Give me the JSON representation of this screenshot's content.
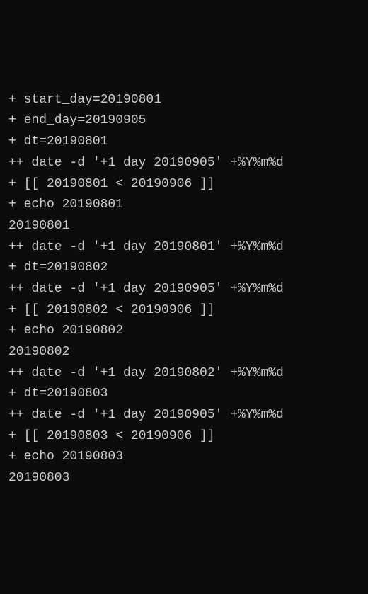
{
  "lines": [
    "+ start_day=20190801",
    "+ end_day=20190905",
    "+ dt=20190801",
    "++ date -d '+1 day 20190905' +%Y%m%d",
    "+ [[ 20190801 < 20190906 ]]",
    "+ echo 20190801",
    "20190801",
    "++ date -d '+1 day 20190801' +%Y%m%d",
    "+ dt=20190802",
    "++ date -d '+1 day 20190905' +%Y%m%d",
    "+ [[ 20190802 < 20190906 ]]",
    "+ echo 20190802",
    "20190802",
    "++ date -d '+1 day 20190802' +%Y%m%d",
    "+ dt=20190803",
    "++ date -d '+1 day 20190905' +%Y%m%d",
    "+ [[ 20190803 < 20190906 ]]",
    "+ echo 20190803",
    "20190803"
  ]
}
